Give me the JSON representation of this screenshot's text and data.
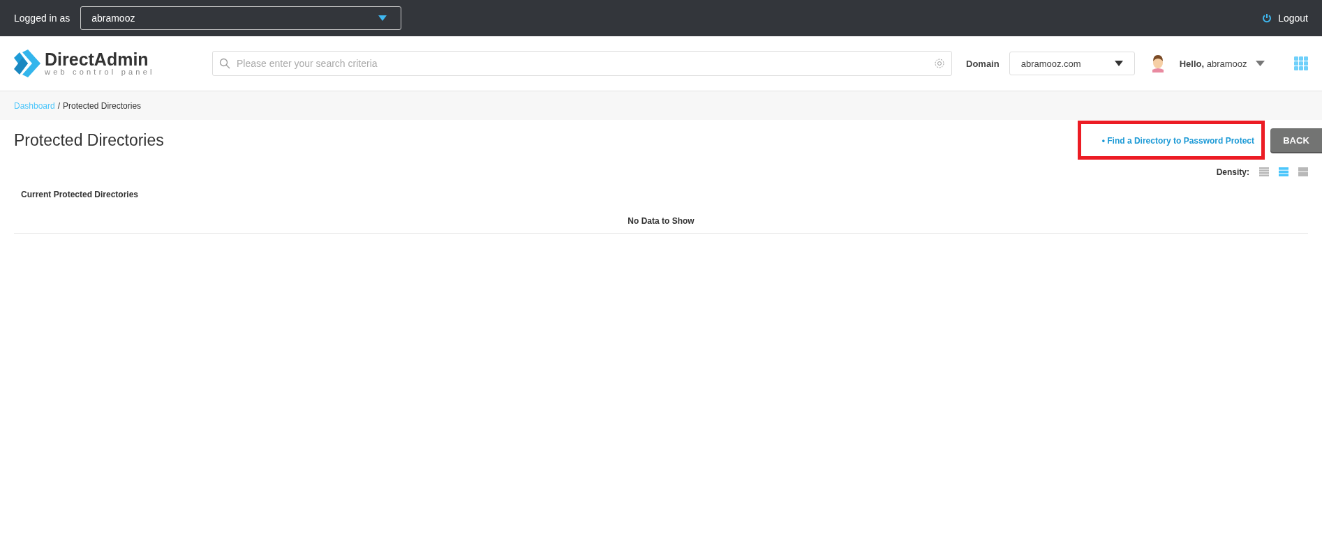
{
  "top_bar": {
    "logged_in_label": "Logged in as",
    "user_select": {
      "value": "abramooz"
    },
    "logout": "Logout"
  },
  "header": {
    "logo": {
      "name": "DirectAdmin",
      "tagline": "web control panel"
    },
    "search": {
      "placeholder": "Please enter your search criteria"
    },
    "domain_label": "Domain",
    "domain_select": {
      "value": "abramooz.com"
    },
    "greeting": {
      "prefix": "Hello,",
      "user": "abramooz"
    }
  },
  "breadcrumb": [
    {
      "label": "Dashboard",
      "kind": "link"
    },
    {
      "label": "/",
      "kind": "separator"
    },
    {
      "label": "Protected Directories",
      "kind": "current"
    }
  ],
  "page": {
    "title": "Protected Directories",
    "action_link": {
      "label": "• Find a Directory to Password Protect",
      "highlighted": true
    },
    "back_button": "BACK"
  },
  "density": {
    "label": "Density:",
    "options": [
      {
        "kind": "compact",
        "selected": false
      },
      {
        "kind": "normal",
        "selected": true
      },
      {
        "kind": "wide",
        "selected": false
      }
    ]
  },
  "table": {
    "title": "Current Protected Directories",
    "empty_message": "No Data to Show"
  }
}
